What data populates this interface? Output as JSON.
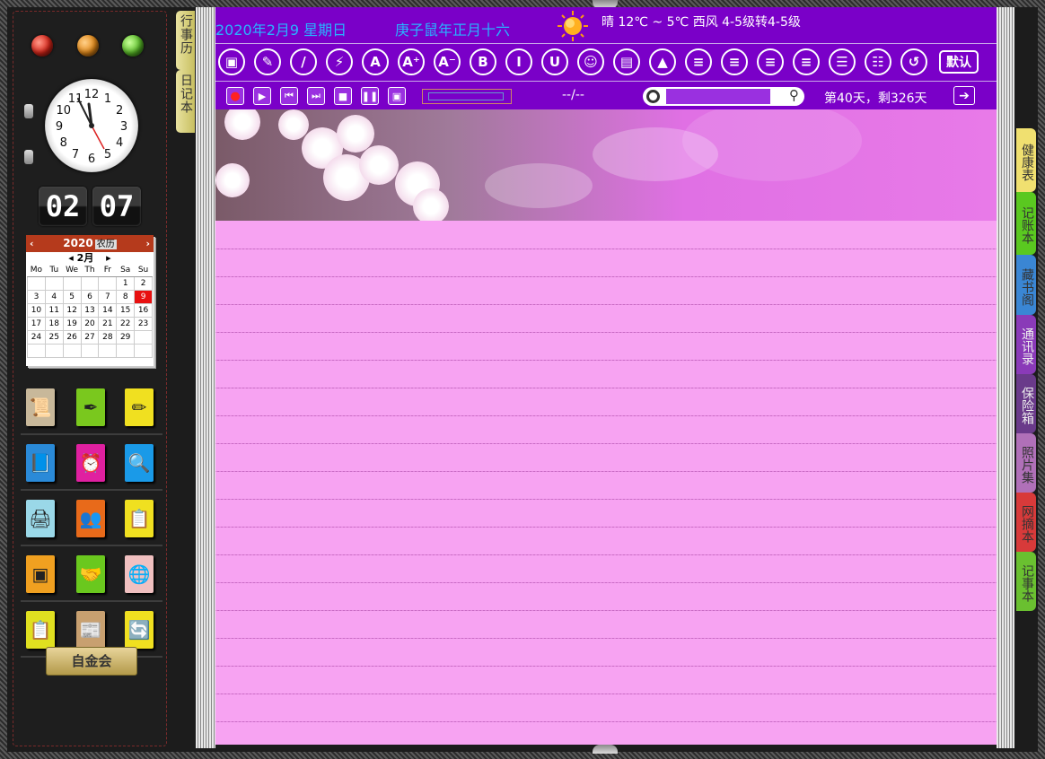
{
  "left_tabs": [
    "行事历",
    "日记本"
  ],
  "clock": {
    "hour_numbers": [
      "12",
      "1",
      "2",
      "3",
      "4",
      "5",
      "6",
      "7",
      "8",
      "9",
      "10",
      "11"
    ]
  },
  "flip_clock": {
    "hours": "02",
    "minutes": "07"
  },
  "calendar": {
    "year": "2020",
    "mode_label": "农历",
    "month_label": "2月",
    "weekdays": [
      "Mo",
      "Tu",
      "We",
      "Th",
      "Fr",
      "Sa",
      "Su"
    ],
    "weeks": [
      [
        "",
        "",
        "",
        "",
        "",
        "1",
        "2"
      ],
      [
        "3",
        "4",
        "5",
        "6",
        "7",
        "8",
        "9"
      ],
      [
        "10",
        "11",
        "12",
        "13",
        "14",
        "15",
        "16"
      ],
      [
        "17",
        "18",
        "19",
        "20",
        "21",
        "22",
        "23"
      ],
      [
        "24",
        "25",
        "26",
        "27",
        "28",
        "29",
        ""
      ],
      [
        "",
        "",
        "",
        "",
        "",
        "",
        ""
      ]
    ],
    "today": "9",
    "today_color": "#e81010"
  },
  "signature_text": "自金会",
  "header": {
    "date": "2020年2月9 星期日",
    "lunar": "庚子鼠年正月十六",
    "weather": "晴 12℃ ~ 5℃ 西风 4-5级转4-5级",
    "accent_color": "#7a00c8",
    "date_color": "#28b4ff"
  },
  "toolbar": {
    "buttons": [
      {
        "name": "save-button",
        "glyph": "▣"
      },
      {
        "name": "eraser-button",
        "glyph": "✎"
      },
      {
        "name": "pen-button",
        "glyph": "/"
      },
      {
        "name": "strike-pen-button",
        "glyph": "⚡"
      },
      {
        "name": "font-color-button",
        "glyph": "A"
      },
      {
        "name": "font-increase-button",
        "glyph": "A⁺"
      },
      {
        "name": "font-decrease-button",
        "glyph": "A⁻"
      },
      {
        "name": "bold-button",
        "glyph": "B"
      },
      {
        "name": "italic-button",
        "glyph": "I"
      },
      {
        "name": "underline-button",
        "glyph": "U"
      },
      {
        "name": "emoji-button",
        "glyph": "☺"
      },
      {
        "name": "insert-doc-button",
        "glyph": "▤"
      },
      {
        "name": "insert-image-button",
        "glyph": "▲"
      },
      {
        "name": "align-left-button",
        "glyph": "≡"
      },
      {
        "name": "align-center-button",
        "glyph": "≡"
      },
      {
        "name": "align-right-button",
        "glyph": "≡"
      },
      {
        "name": "align-justify-button",
        "glyph": "≡"
      },
      {
        "name": "line-spacing-button",
        "glyph": "☰"
      },
      {
        "name": "list-button",
        "glyph": "☷"
      },
      {
        "name": "undo-button",
        "glyph": "↺"
      }
    ],
    "default_label": "默认"
  },
  "media": {
    "timecode": "--/--",
    "days_status": "第40天，剩326天"
  },
  "right_tabs": [
    "健康表",
    "记账本",
    "藏书阁",
    "通讯录",
    "保险箱",
    "照片集",
    "网摘本",
    "记事本"
  ]
}
